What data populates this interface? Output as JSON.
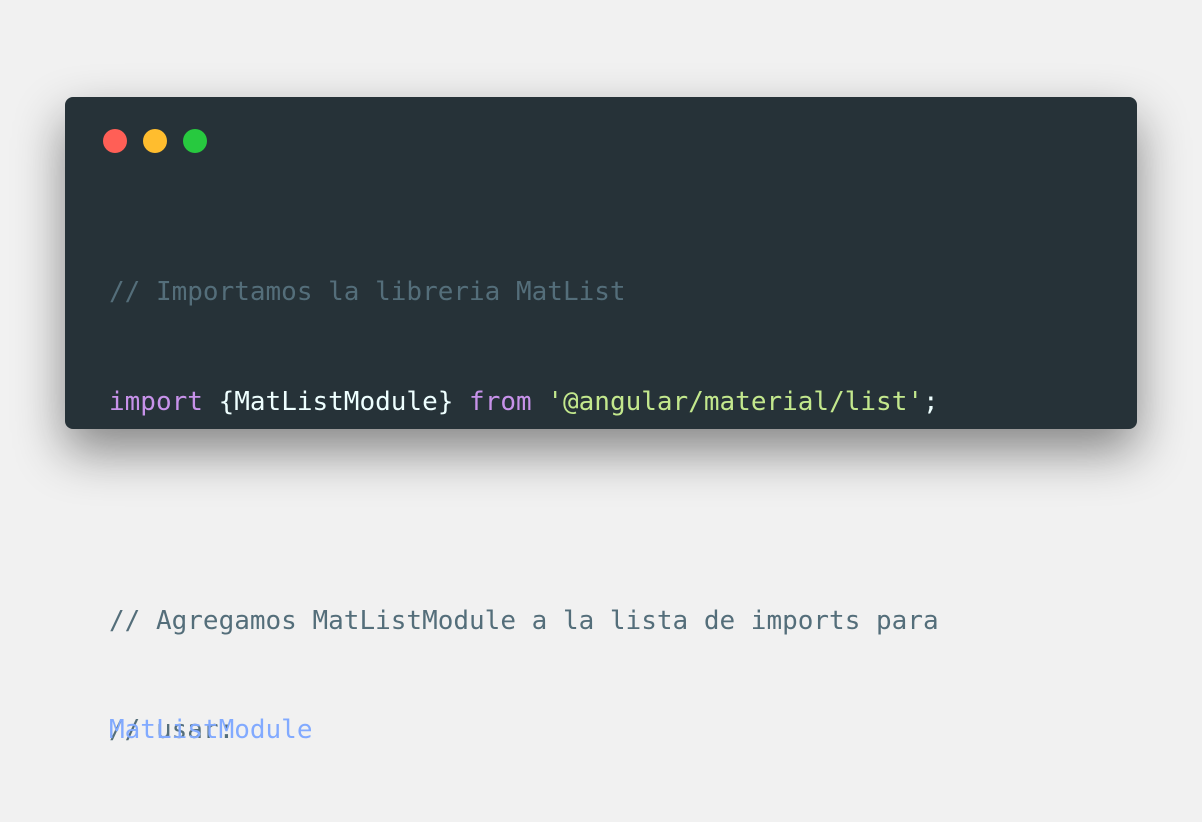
{
  "window": {
    "controls": [
      {
        "name": "close",
        "color": "#ff5f56"
      },
      {
        "name": "minimize",
        "color": "#ffbd2e"
      },
      {
        "name": "maximize",
        "color": "#27c93f"
      }
    ]
  },
  "code": {
    "line1_comment": "// Importamos la libreria MatList",
    "line2_import_kw": "import",
    "line2_open_brace": "{",
    "line2_identifier": "MatListModule",
    "line2_close_brace": "}",
    "line2_from_kw": "from",
    "line2_module_path": "'@angular/material/list'",
    "line2_semicolon": ";",
    "line4_comment": "// Agregamos MatListModule a la lista de imports para",
    "line5_comment_wrap": "// usar:",
    "line5_identifier": "MatListModule"
  }
}
